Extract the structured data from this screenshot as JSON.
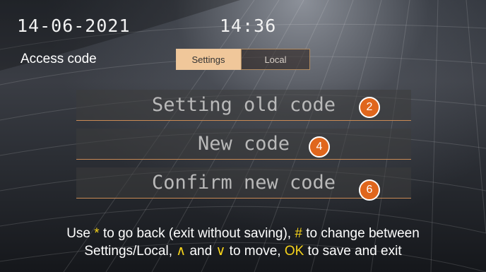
{
  "status": {
    "date": "14-06-2021",
    "time": "14:36"
  },
  "page": {
    "title": "Access code"
  },
  "tabs": [
    {
      "label": "Settings",
      "active": true
    },
    {
      "label": "Local",
      "active": false
    }
  ],
  "fields": [
    {
      "label": "Setting old code",
      "badge": "2"
    },
    {
      "label": "New code",
      "badge": "4"
    },
    {
      "label": "Confirm new code",
      "badge": "6"
    }
  ],
  "help": {
    "line1": {
      "a": "Use ",
      "k1": "*",
      "b": " to go back (exit without saving), ",
      "k2": "#",
      "c": " to change between"
    },
    "line2": {
      "a": "Settings/Local, ",
      "k1": "∧",
      "b": " and ",
      "k2": "∨",
      "c": " to move, ",
      "k3": "OK",
      "d": " to save and exit"
    }
  },
  "colors": {
    "accent": "#e0661c",
    "highlight": "#f5d21b",
    "tab_active": "#f0c79a"
  }
}
